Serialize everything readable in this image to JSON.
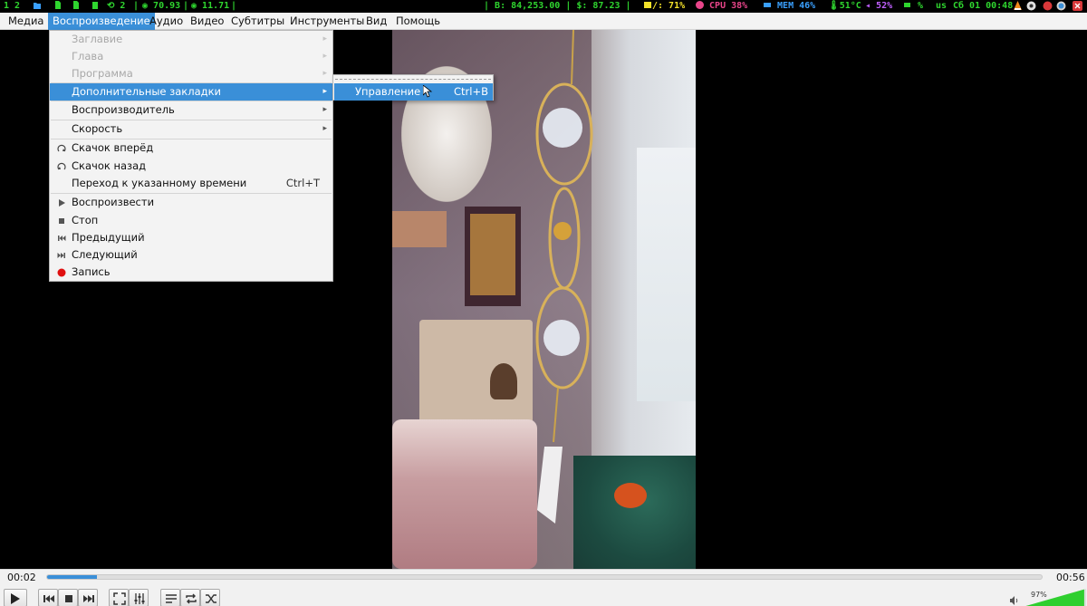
{
  "sysbar": {
    "workspaces": "1 2",
    "terminal_count": "2",
    "loadavg_1": "70.93",
    "loadavg_2": "11.71",
    "btc": "B: 84,253.00 | $: 87.23",
    "disk": "/: 71%",
    "cpu": "CPU 38%",
    "mem": "MEM 46%",
    "temp": "51°C",
    "volume": "52%",
    "battery": "%",
    "layout": "us",
    "datetime": "Сб 01 00:48",
    "colors": {
      "green": "#2fd52f",
      "yellow": "#f2e12a",
      "pink": "#e8458a",
      "blue": "#3aa0ff",
      "purple": "#c060ff"
    }
  },
  "menubar": {
    "items": [
      "Медиа",
      "Воспроизведение",
      "Аудио",
      "Видео",
      "Субтитры",
      "Инструменты",
      "Вид",
      "Помощь"
    ],
    "active": "Воспроизведение"
  },
  "menu": {
    "title_item": "Заглавие",
    "chapter_item": "Глава",
    "program_item": "Программа",
    "bookmarks_item": "Дополнительные закладки",
    "renderer_item": "Воспроизводитель",
    "speed_item": "Скорость",
    "jump_forward": "Скачок вперёд",
    "jump_backward": "Скачок назад",
    "goto_time": "Переход к указанному времени",
    "goto_time_shortcut": "Ctrl+T",
    "play": "Воспроизвести",
    "stop": "Стоп",
    "previous": "Предыдущий",
    "next": "Следующий",
    "record": "Запись"
  },
  "submenu": {
    "manage": "Управление",
    "manage_shortcut": "Ctrl+B"
  },
  "controls": {
    "elapsed": "00:02",
    "total": "00:56",
    "progress_fraction": 0.05,
    "volume_label": "97%",
    "volume_fraction": 0.97,
    "accent": "#3a8fd8"
  }
}
